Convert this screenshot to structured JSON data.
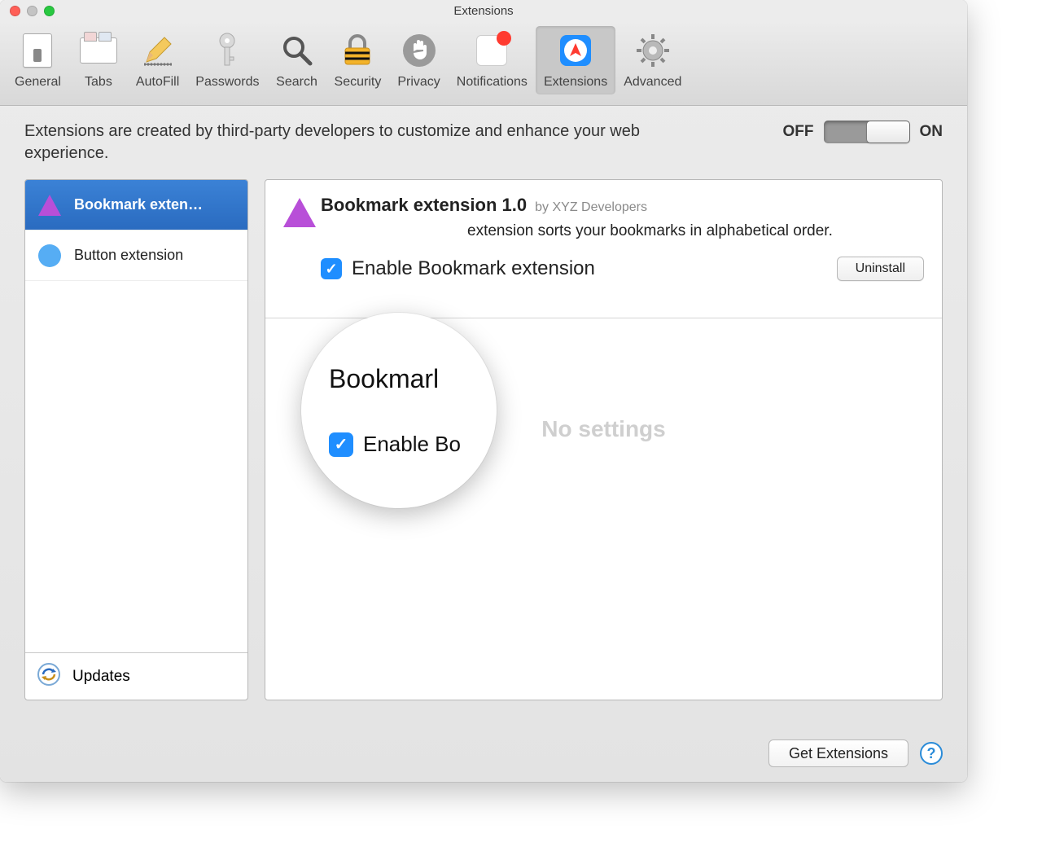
{
  "window": {
    "title": "Extensions"
  },
  "toolbar": {
    "items": [
      {
        "label": "General"
      },
      {
        "label": "Tabs"
      },
      {
        "label": "AutoFill"
      },
      {
        "label": "Passwords"
      },
      {
        "label": "Search"
      },
      {
        "label": "Security"
      },
      {
        "label": "Privacy"
      },
      {
        "label": "Notifications"
      },
      {
        "label": "Extensions"
      },
      {
        "label": "Advanced"
      }
    ]
  },
  "intro": "Extensions are created by third-party developers to customize and enhance your web experience.",
  "toggle": {
    "off": "OFF",
    "on": "ON",
    "state": "on"
  },
  "sidebar": {
    "items": [
      {
        "label": "Bookmark exten…",
        "selected": true
      },
      {
        "label": "Button extension",
        "selected": false
      }
    ],
    "footer": "Updates"
  },
  "detail": {
    "name": "Bookmark extension",
    "version": "1.0",
    "title_full": "Bookmark extension 1.0",
    "by_prefix": "by",
    "author": "XYZ Developers",
    "description_suffix": "extension sorts your bookmarks in alphabetical order.",
    "enable_label": "Enable Bookmark extension",
    "enable_short": "Enable Bo",
    "uninstall": "Uninstall",
    "no_settings": "No settings"
  },
  "magnifier": {
    "top": "Bookmarl",
    "enable": "Enable Bo"
  },
  "footer": {
    "get_extensions": "Get Extensions"
  }
}
